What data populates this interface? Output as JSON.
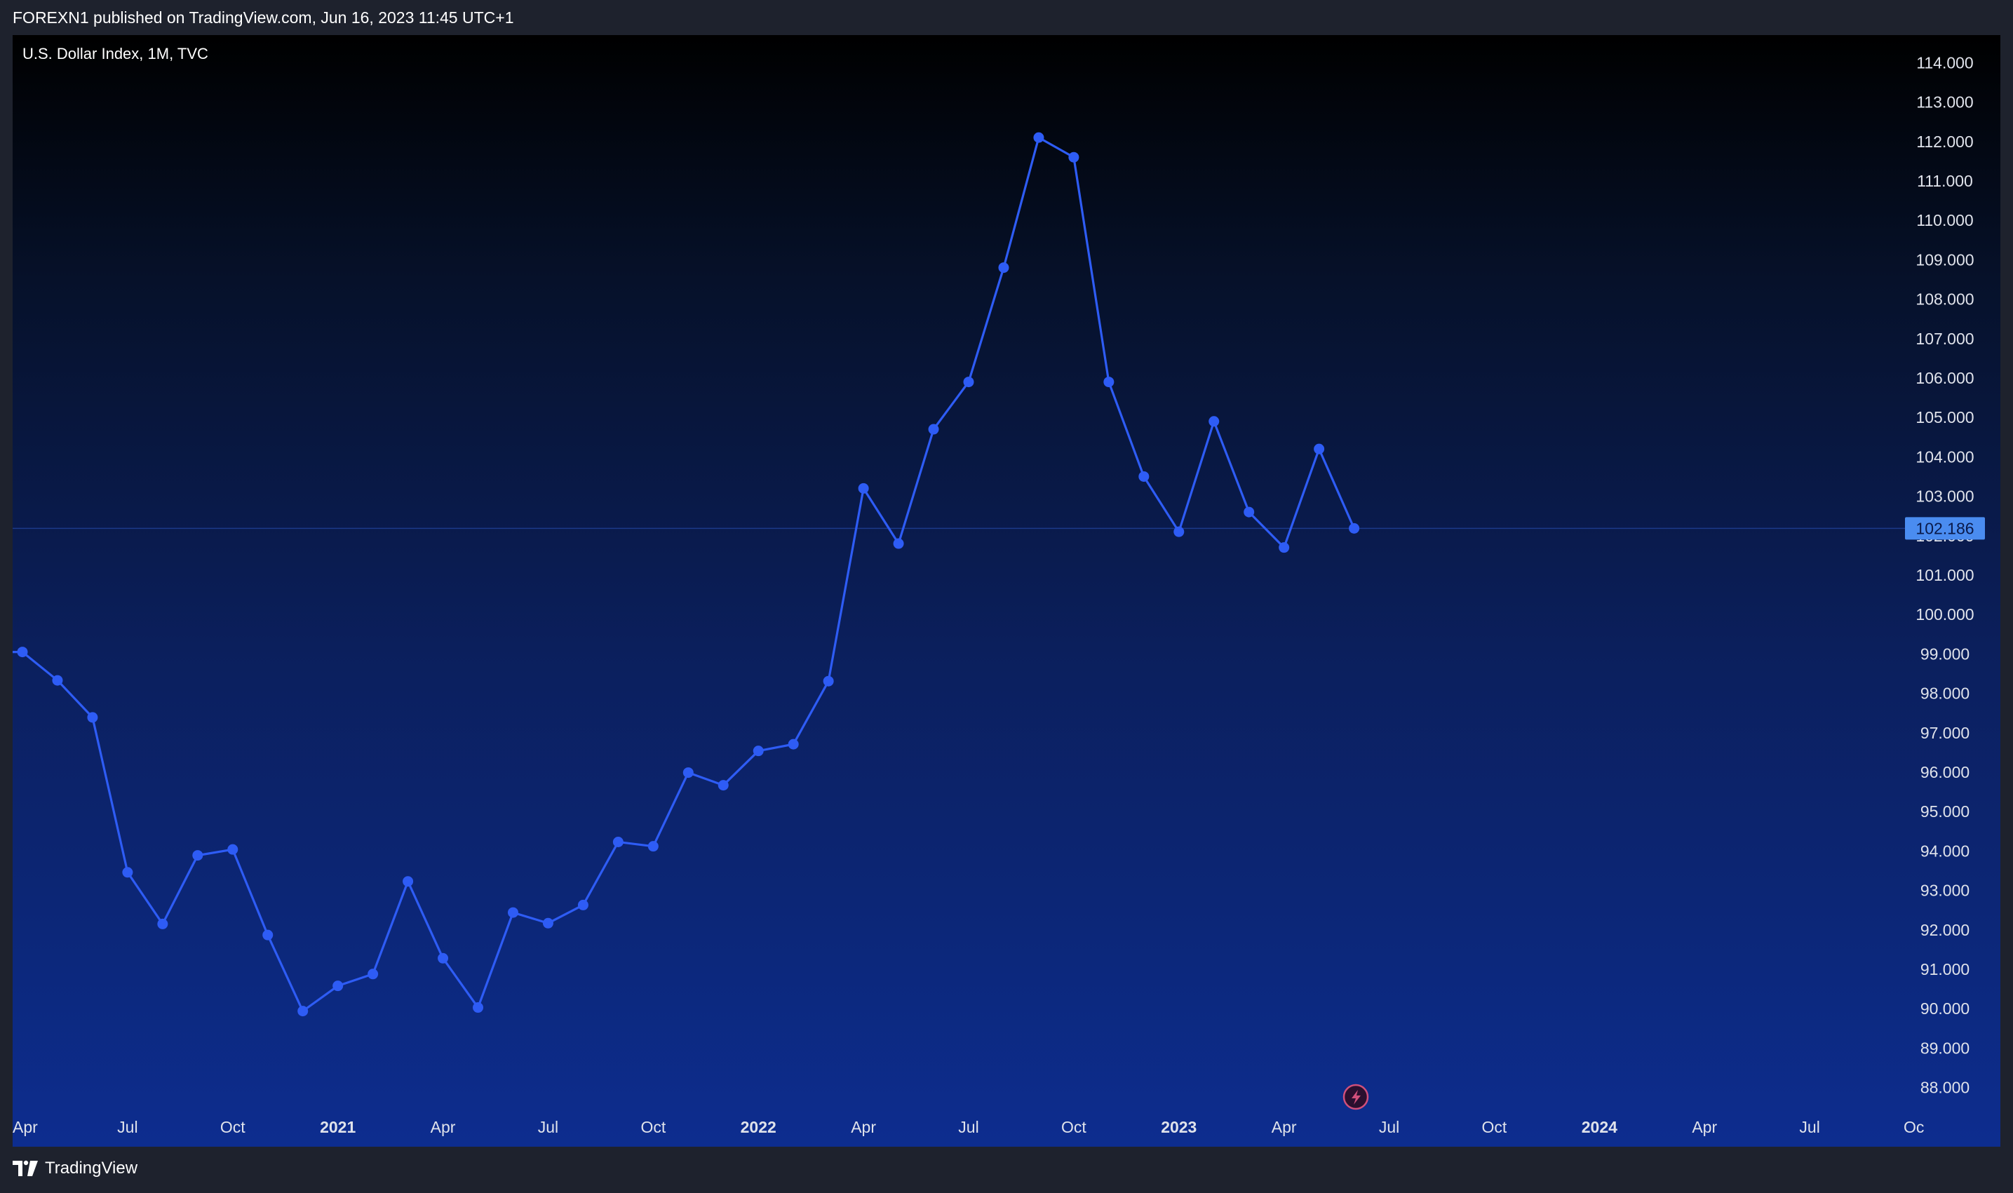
{
  "header": {
    "published_text": "FOREXN1 published on TradingView.com, Jun 16, 2023 11:45 UTC+1"
  },
  "legend": {
    "symbol_text": "U.S. Dollar Index, 1M, TVC"
  },
  "footer": {
    "brand_name": "TradingView",
    "logo_icon": "tradingview-logo-icon"
  },
  "colors": {
    "line": "#2e5cf5",
    "price_label_bg": "#4a8cf0",
    "axis_text": "#e0e3eb"
  },
  "chart_data": {
    "type": "line",
    "title": "U.S. Dollar Index, 1M, TVC",
    "x": [
      "2020-04",
      "2020-05",
      "2020-06",
      "2020-07",
      "2020-08",
      "2020-09",
      "2020-10",
      "2020-11",
      "2020-12",
      "2021-01",
      "2021-02",
      "2021-03",
      "2021-04",
      "2021-05",
      "2021-06",
      "2021-07",
      "2021-08",
      "2021-09",
      "2021-10",
      "2021-11",
      "2021-12",
      "2022-01",
      "2022-02",
      "2022-03",
      "2022-04",
      "2022-05",
      "2022-06",
      "2022-07",
      "2022-08",
      "2022-09",
      "2022-10",
      "2022-11",
      "2022-12",
      "2023-01",
      "2023-02",
      "2023-03",
      "2023-04",
      "2023-05",
      "2023-06"
    ],
    "series": [
      {
        "values": [
          99.05,
          98.33,
          97.39,
          93.46,
          92.15,
          93.89,
          94.04,
          91.87,
          89.94,
          90.58,
          90.88,
          93.23,
          91.28,
          90.03,
          92.44,
          92.17,
          92.63,
          94.23,
          94.12,
          95.99,
          95.67,
          96.54,
          96.71,
          98.31,
          103.2,
          101.8,
          104.7,
          105.9,
          108.8,
          112.1,
          111.6,
          105.9,
          103.5,
          102.1,
          104.9,
          102.6,
          101.7,
          104.2,
          102.186
        ]
      }
    ],
    "x_axis": {
      "range": [
        "2020-04",
        "2024-10"
      ],
      "tick_labels": [
        {
          "label": "Apr",
          "date": "2020-04",
          "bold": false
        },
        {
          "label": "Jul",
          "date": "2020-07",
          "bold": false
        },
        {
          "label": "Oct",
          "date": "2020-10",
          "bold": false
        },
        {
          "label": "2021",
          "date": "2021-01",
          "bold": true
        },
        {
          "label": "Apr",
          "date": "2021-04",
          "bold": false
        },
        {
          "label": "Jul",
          "date": "2021-07",
          "bold": false
        },
        {
          "label": "Oct",
          "date": "2021-10",
          "bold": false
        },
        {
          "label": "2022",
          "date": "2022-01",
          "bold": true
        },
        {
          "label": "Apr",
          "date": "2022-04",
          "bold": false
        },
        {
          "label": "Jul",
          "date": "2022-07",
          "bold": false
        },
        {
          "label": "Oct",
          "date": "2022-10",
          "bold": false
        },
        {
          "label": "2023",
          "date": "2023-01",
          "bold": true
        },
        {
          "label": "Apr",
          "date": "2023-04",
          "bold": false
        },
        {
          "label": "Jul",
          "date": "2023-07",
          "bold": false
        },
        {
          "label": "Oct",
          "date": "2023-10",
          "bold": false
        },
        {
          "label": "2024",
          "date": "2024-01",
          "bold": true
        },
        {
          "label": "Apr",
          "date": "2024-04",
          "bold": false
        },
        {
          "label": "Jul",
          "date": "2024-07",
          "bold": false
        },
        {
          "label": "Oc",
          "date": "2024-10",
          "bold": false
        }
      ]
    },
    "y_axis": {
      "ylim": [
        87.3,
        114.7
      ],
      "position": "right",
      "tick_labels": [
        "88.000",
        "89.000",
        "90.000",
        "91.000",
        "92.000",
        "93.000",
        "94.000",
        "95.000",
        "96.000",
        "97.000",
        "98.000",
        "99.000",
        "100.000",
        "101.000",
        "102.000",
        "103.000",
        "104.000",
        "105.000",
        "106.000",
        "107.000",
        "108.000",
        "109.000",
        "110.000",
        "111.000",
        "112.000",
        "113.000",
        "114.000"
      ]
    },
    "last_price": {
      "value": 102.186,
      "label": "102.186"
    },
    "grid": false,
    "markers": "circle"
  }
}
